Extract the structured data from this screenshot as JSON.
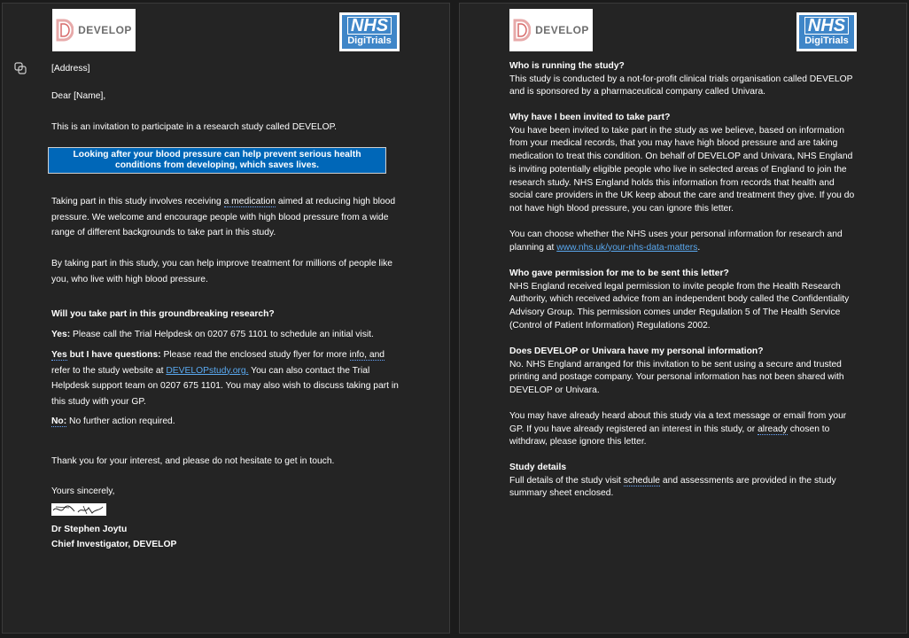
{
  "logos": {
    "develop_text": "DEVELOP",
    "develop_letter": "D",
    "nhs_text": "NHS",
    "nhs_sub": "DigiTrials"
  },
  "left": {
    "address": "[Address]",
    "salutation": "Dear [Name],",
    "intro": "This is an invitation to participate in a research study called DEVELOP.",
    "banner": "Looking after your blood pressure can help prevent serious health conditions from developing, which saves lives.",
    "p1_a": "Taking part in this study involves receiving ",
    "p1_link": "a medication",
    "p1_b": " aimed at reducing high blood",
    "p1_l2": "pressure. We welcome and encourage people with high blood pressure from a wide",
    "p1_l3": "range of different backgrounds to take part in this study.",
    "p2_l1": "By taking part in this study, you can help improve treatment for millions of people like",
    "p2_l2": "you, who live with high blood pressure.",
    "question_heading": "Will you take part in this groundbreaking research?",
    "yes_label": "Yes:",
    "yes_text": " Please call the Trial Helpdesk on 0207 675 1101 to schedule an initial visit.",
    "yesq_label": "Yes",
    "yesq_label2": " but I have questions:",
    "yesq_l1a": " Please read the enclosed study flyer for more ",
    "yesq_l1b": "info, and",
    "yesq_l2a": "refer to the study website at ",
    "yesq_link": "DEVELOPstudy.org.",
    "yesq_l2b": " You can also contact the Trial",
    "yesq_l3": "Helpdesk support team on 0207 675 1101. You may also wish to discuss taking part in",
    "yesq_l4": "this study with your GP.",
    "no_label": "No:",
    "no_text": " No further action required.",
    "thanks": "Thank you for your interest, and please do not hesitate to get in touch.",
    "closing": "Yours sincerely,",
    "signer_name": "Dr Stephen Joytu",
    "signer_title": "Chief Investigator, DEVELOP"
  },
  "right": {
    "s1_heading": "Who is running the study?",
    "s1_l1": "This study is conducted by a not-for-profit clinical trials organisation called DEVELOP",
    "s1_l2": "and is sponsored by a pharmaceutical company called Univara.",
    "s2_heading": "Why have I been invited to take part?",
    "s2_l1": "You have been invited to take part in the study as we believe, based on information",
    "s2_l2": "from your medical records, that you may have high blood pressure and are taking",
    "s2_l3": "medication to treat this condition. On behalf of DEVELOP and Univara, NHS England",
    "s2_l4": "is inviting potentially eligible people who live in selected areas of England to join the",
    "s2_l5": "research study. NHS England holds this information from records that health and",
    "s2_l6": "social care providers in the UK keep about the care and treatment they give. If you do",
    "s2_l7": "not have high blood pressure, you can ignore this letter.",
    "s3_l1": "You can choose whether the NHS uses your personal information for research and",
    "s3_l2a": "planning at ",
    "s3_link": "www.nhs.uk/your-nhs-data-matters",
    "s3_l2b": ".",
    "s4_heading": "Who gave permission for me to be sent this letter?",
    "s4_l1": "NHS England received legal permission to invite people from the Health Research",
    "s4_l2": "Authority, which received advice from an independent body called the Confidentiality",
    "s4_l3": "Advisory Group. This permission comes under Regulation 5 of The Health Service",
    "s4_l4": "(Control of Patient Information) Regulations 2002.",
    "s5_heading": "Does DEVELOP or Univara have my personal information?",
    "s5_l1": "No. NHS England arranged for this invitation to be sent using a secure and trusted",
    "s5_l2": "printing and postage company. Your personal information has not been shared with",
    "s5_l3": "DEVELOP or Univara.",
    "s6_l1": "You may have already heard about this study via a text message or email from your",
    "s6_l2a": "GP. If you have already registered an interest in this study, or ",
    "s6_squig": "already",
    "s6_l2b": " chosen to",
    "s6_l3": "withdraw, please ignore this letter.",
    "s7_heading": "Study details",
    "s7_l1a": "Full details of the study visit ",
    "s7_squig": "schedule",
    "s7_l1b": " and assessments are provided in the study",
    "s7_l2": "summary sheet enclosed."
  }
}
